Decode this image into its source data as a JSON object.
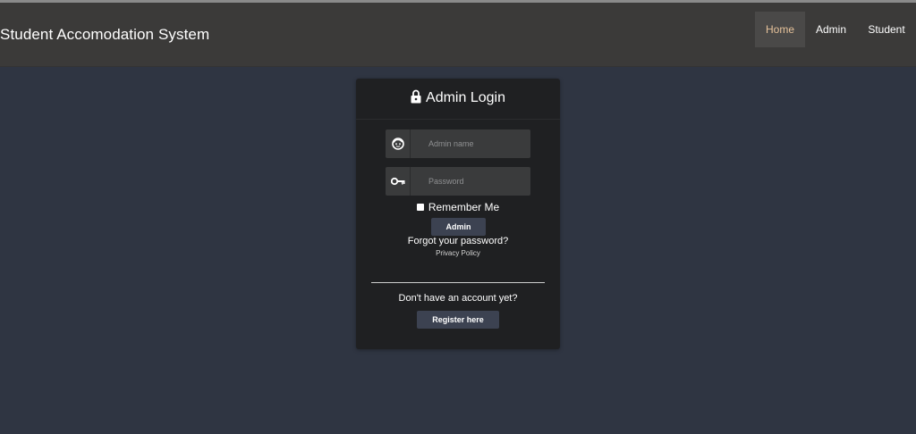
{
  "navbar": {
    "brand": "Student Accomodation System",
    "items": [
      {
        "label": "Home",
        "active": true
      },
      {
        "label": "Admin",
        "active": false
      },
      {
        "label": "Student",
        "active": false
      }
    ]
  },
  "login": {
    "title": "Admin Login",
    "title_icon": "lock-icon",
    "username": {
      "icon": "user-face-icon",
      "placeholder": "Admin name",
      "value": ""
    },
    "password": {
      "icon": "key-icon",
      "placeholder": "Password",
      "value": ""
    },
    "remember_label": "Remember Me",
    "remember_checked": false,
    "submit_label": "Admin",
    "forgot_label": "Forgot your password?",
    "privacy_label": "Privacy Policy",
    "no_account_text": "Don't have an account yet?",
    "register_label": "Register here"
  },
  "colors": {
    "background": "#2f3542",
    "navbar": "#3b3a39",
    "card": "#1f2022",
    "input": "#3a3b3c",
    "button": "#3c4251",
    "active_nav_text": "#e6c29a"
  }
}
